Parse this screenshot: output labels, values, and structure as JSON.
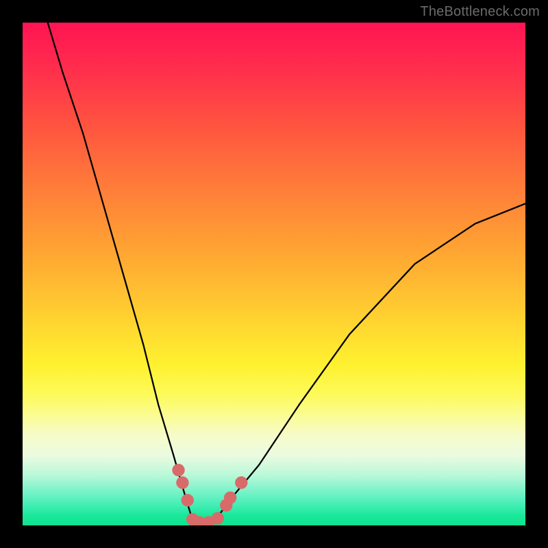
{
  "watermark": "TheBottleneck.com",
  "colors": {
    "frame": "#000000",
    "curve": "#000000",
    "marker_fill": "#d96a6a",
    "marker_stroke": "#c44f4f"
  },
  "chart_data": {
    "type": "line",
    "title": "",
    "xlabel": "",
    "ylabel": "",
    "xlim": [
      0,
      100
    ],
    "ylim": [
      0,
      100
    ],
    "grid": false,
    "legend": false,
    "note": "No axis ticks or numeric labels are rendered; values below are estimated plot-space percentages (0 at bottom-left, 100 at top-right).",
    "series": [
      {
        "name": "bottleneck-curve",
        "x": [
          5,
          8,
          12,
          16,
          20,
          24,
          27,
          30,
          32,
          33.5,
          35,
          37,
          39,
          42,
          47,
          55,
          65,
          78,
          90,
          100
        ],
        "y": [
          100,
          90,
          78,
          64,
          50,
          36,
          24,
          14,
          7,
          2,
          0,
          0.5,
          2,
          6,
          12,
          24,
          38,
          52,
          60,
          64
        ]
      }
    ],
    "markers": [
      {
        "name": "left-band-marker-1",
        "x": 31.0,
        "y": 11.0
      },
      {
        "name": "left-band-marker-2",
        "x": 31.8,
        "y": 8.5
      },
      {
        "name": "left-band-marker-3",
        "x": 32.8,
        "y": 5.0
      },
      {
        "name": "bottom-marker-1",
        "x": 33.8,
        "y": 1.2
      },
      {
        "name": "bottom-marker-2",
        "x": 35.2,
        "y": 0.6
      },
      {
        "name": "bottom-marker-3",
        "x": 37.0,
        "y": 0.6
      },
      {
        "name": "bottom-marker-4",
        "x": 38.8,
        "y": 1.4
      },
      {
        "name": "right-band-marker-1",
        "x": 40.5,
        "y": 4.0
      },
      {
        "name": "right-band-marker-2",
        "x": 41.3,
        "y": 5.5
      },
      {
        "name": "right-band-marker-3",
        "x": 43.5,
        "y": 8.5
      }
    ],
    "marker_radius_pct": 1.25
  }
}
